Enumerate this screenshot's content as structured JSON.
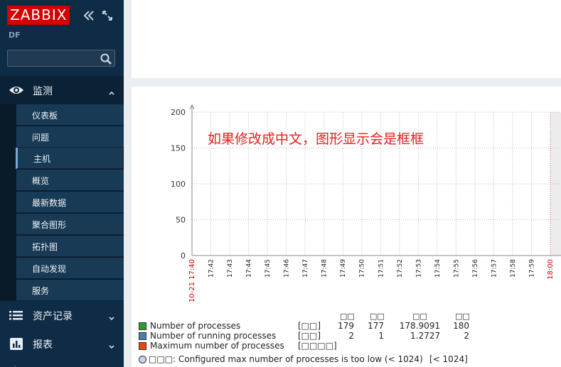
{
  "sidebar": {
    "logo": "ZABBIX",
    "server_name": "DF",
    "search": {
      "placeholder": "",
      "value": ""
    },
    "sections": {
      "monitoring": "监测",
      "assets": "资产记录",
      "reports": "报表"
    },
    "submenu": [
      {
        "label": "仪表板"
      },
      {
        "label": "问题"
      },
      {
        "label": "主机",
        "active": true
      },
      {
        "label": "概览"
      },
      {
        "label": "最新数据"
      },
      {
        "label": "聚合图形"
      },
      {
        "label": "拓扑图"
      },
      {
        "label": "自动发现"
      },
      {
        "label": "服务"
      }
    ],
    "colors": {
      "bg": "#0e2c46",
      "submenu": "#183a55",
      "logo_bg": "#d40000"
    }
  },
  "graph": {
    "annotation": "如果修改成中文，图形显示会是框框",
    "legend": {
      "stat_headers": [
        "□□",
        "□□",
        "□□",
        "□□"
      ],
      "items": [
        {
          "name": "Number of processes",
          "unit": "[□□]",
          "color": "#339933",
          "values": [
            "179",
            "177",
            "178.9091",
            "180"
          ]
        },
        {
          "name": "Number of running processes",
          "unit": "[□□]",
          "color": "#4a7fa5",
          "values": [
            "2",
            "1",
            "1.2727",
            "2"
          ]
        },
        {
          "name": "Maximum number of processes",
          "unit": "[□□□□]",
          "color": "#ee4411",
          "values": []
        }
      ],
      "trigger": {
        "text": "□□□: Configured max number of processes is too low (< 1024)",
        "condition": "[< 1024]"
      }
    }
  },
  "chart_data": {
    "type": "line",
    "x": [
      "10-21 17:40",
      "17:42",
      "17:43",
      "17:44",
      "17:45",
      "17:46",
      "17:47",
      "17:48",
      "17:49",
      "17:50",
      "17:51",
      "17:52",
      "17:53",
      "17:54",
      "17:55",
      "17:56",
      "17:57",
      "17:58",
      "17:59",
      "18:00"
    ],
    "x_highlight": [
      "10-21 17:40",
      "18:00"
    ],
    "y_ticks": [
      0,
      50,
      100,
      150,
      200
    ],
    "ylim": [
      0,
      200
    ],
    "grid": true,
    "series": [
      {
        "name": "Number of processes",
        "color": "#339933",
        "values": []
      },
      {
        "name": "Number of running processes",
        "color": "#4a7fa5",
        "values": []
      },
      {
        "name": "Maximum number of processes",
        "color": "#ee4411",
        "values": []
      }
    ]
  }
}
